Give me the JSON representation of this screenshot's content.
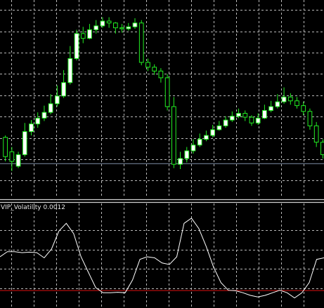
{
  "chart_data": [
    {
      "type": "candlestick",
      "title": "",
      "grid": true,
      "colors": {
        "background": "#000000",
        "grid": "#b8b8b8",
        "candle_up": "#ffffff",
        "candle_outline": "#22ee22",
        "wick": "#22ee22",
        "hline": "#7f8fa8"
      },
      "ohlc": [
        [
          0.6,
          0.4,
          0.62,
          0.35
        ],
        [
          0.45,
          0.35,
          0.5,
          0.25
        ],
        [
          0.3,
          0.42,
          0.45,
          0.28
        ],
        [
          0.42,
          0.66,
          0.75,
          0.4
        ],
        [
          0.66,
          0.74,
          0.78,
          0.62
        ],
        [
          0.74,
          0.8,
          0.86,
          0.7
        ],
        [
          0.8,
          0.86,
          0.93,
          0.77
        ],
        [
          0.86,
          0.95,
          1.05,
          0.84
        ],
        [
          0.95,
          1.03,
          1.14,
          0.92
        ],
        [
          1.03,
          1.17,
          1.3,
          1.01
        ],
        [
          1.17,
          1.42,
          1.55,
          1.15
        ],
        [
          1.42,
          1.68,
          1.72,
          1.4
        ],
        [
          1.68,
          1.63,
          1.75,
          1.58
        ],
        [
          1.63,
          1.72,
          1.78,
          1.62
        ],
        [
          1.72,
          1.76,
          1.82,
          1.68
        ],
        [
          1.76,
          1.81,
          1.85,
          1.74
        ],
        [
          1.81,
          1.79,
          1.85,
          1.74
        ],
        [
          1.79,
          1.74,
          1.8,
          1.68
        ],
        [
          1.74,
          1.73,
          1.78,
          1.69
        ],
        [
          1.73,
          1.75,
          1.79,
          1.71
        ],
        [
          1.75,
          1.79,
          1.84,
          1.73
        ],
        [
          1.79,
          1.38,
          1.82,
          1.35
        ],
        [
          1.38,
          1.33,
          1.42,
          1.29
        ],
        [
          1.33,
          1.29,
          1.36,
          1.25
        ],
        [
          1.29,
          1.22,
          1.32,
          1.17
        ],
        [
          1.22,
          0.92,
          1.26,
          0.88
        ],
        [
          0.92,
          0.32,
          1.02,
          0.28
        ],
        [
          0.32,
          0.38,
          0.45,
          0.27
        ],
        [
          0.38,
          0.46,
          0.5,
          0.34
        ],
        [
          0.46,
          0.52,
          0.58,
          0.43
        ],
        [
          0.52,
          0.58,
          0.64,
          0.5
        ],
        [
          0.58,
          0.62,
          0.67,
          0.56
        ],
        [
          0.62,
          0.68,
          0.73,
          0.6
        ],
        [
          0.68,
          0.72,
          0.77,
          0.67
        ],
        [
          0.72,
          0.78,
          0.82,
          0.7
        ],
        [
          0.78,
          0.82,
          0.87,
          0.76
        ],
        [
          0.82,
          0.85,
          0.9,
          0.8
        ],
        [
          0.85,
          0.81,
          0.88,
          0.77
        ],
        [
          0.81,
          0.75,
          0.83,
          0.72
        ],
        [
          0.75,
          0.8,
          0.85,
          0.73
        ],
        [
          0.8,
          0.88,
          0.94,
          0.79
        ],
        [
          0.88,
          0.92,
          0.98,
          0.86
        ],
        [
          0.92,
          0.97,
          1.05,
          0.9
        ],
        [
          0.97,
          1.02,
          1.12,
          0.95
        ],
        [
          1.02,
          0.98,
          1.06,
          0.94
        ],
        [
          0.98,
          0.93,
          1.02,
          0.9
        ],
        [
          0.93,
          0.87,
          0.97,
          0.83
        ],
        [
          0.87,
          0.72,
          0.9,
          0.68
        ],
        [
          0.72,
          0.55,
          0.76,
          0.5
        ],
        [
          0.55,
          0.42,
          0.58,
          0.38
        ]
      ],
      "price_min": 0,
      "price_max": 2.0,
      "hline_value": 0.33
    },
    {
      "type": "line",
      "title": "VIP_Volatility 0.0012",
      "grid": true,
      "colors": {
        "background": "#000000",
        "grid": "#b8b8b8",
        "line": "#ffffff",
        "level": "#dd1111"
      },
      "values": [
        0.0009,
        0.001,
        0.001,
        0.00098,
        0.00099,
        0.00098,
        0.00088,
        0.00105,
        0.0014,
        0.00155,
        0.00135,
        0.0009,
        0.0006,
        0.0003,
        0.0002,
        0.0002,
        0.00021,
        0.0002,
        0.00045,
        0.00085,
        0.0009,
        0.00088,
        0.00078,
        0.00075,
        0.0009,
        0.00155,
        0.00165,
        0.00145,
        0.0011,
        0.0007,
        0.0004,
        0.00025,
        0.00024,
        0.0002,
        0.00015,
        0.00012,
        0.00015,
        0.0002,
        0.00025,
        0.0002,
        0.0001,
        0.0002,
        0.0004,
        0.00085,
        0.00088
      ],
      "level": 0.00025,
      "ylim": [
        0,
        0.0018
      ]
    }
  ]
}
